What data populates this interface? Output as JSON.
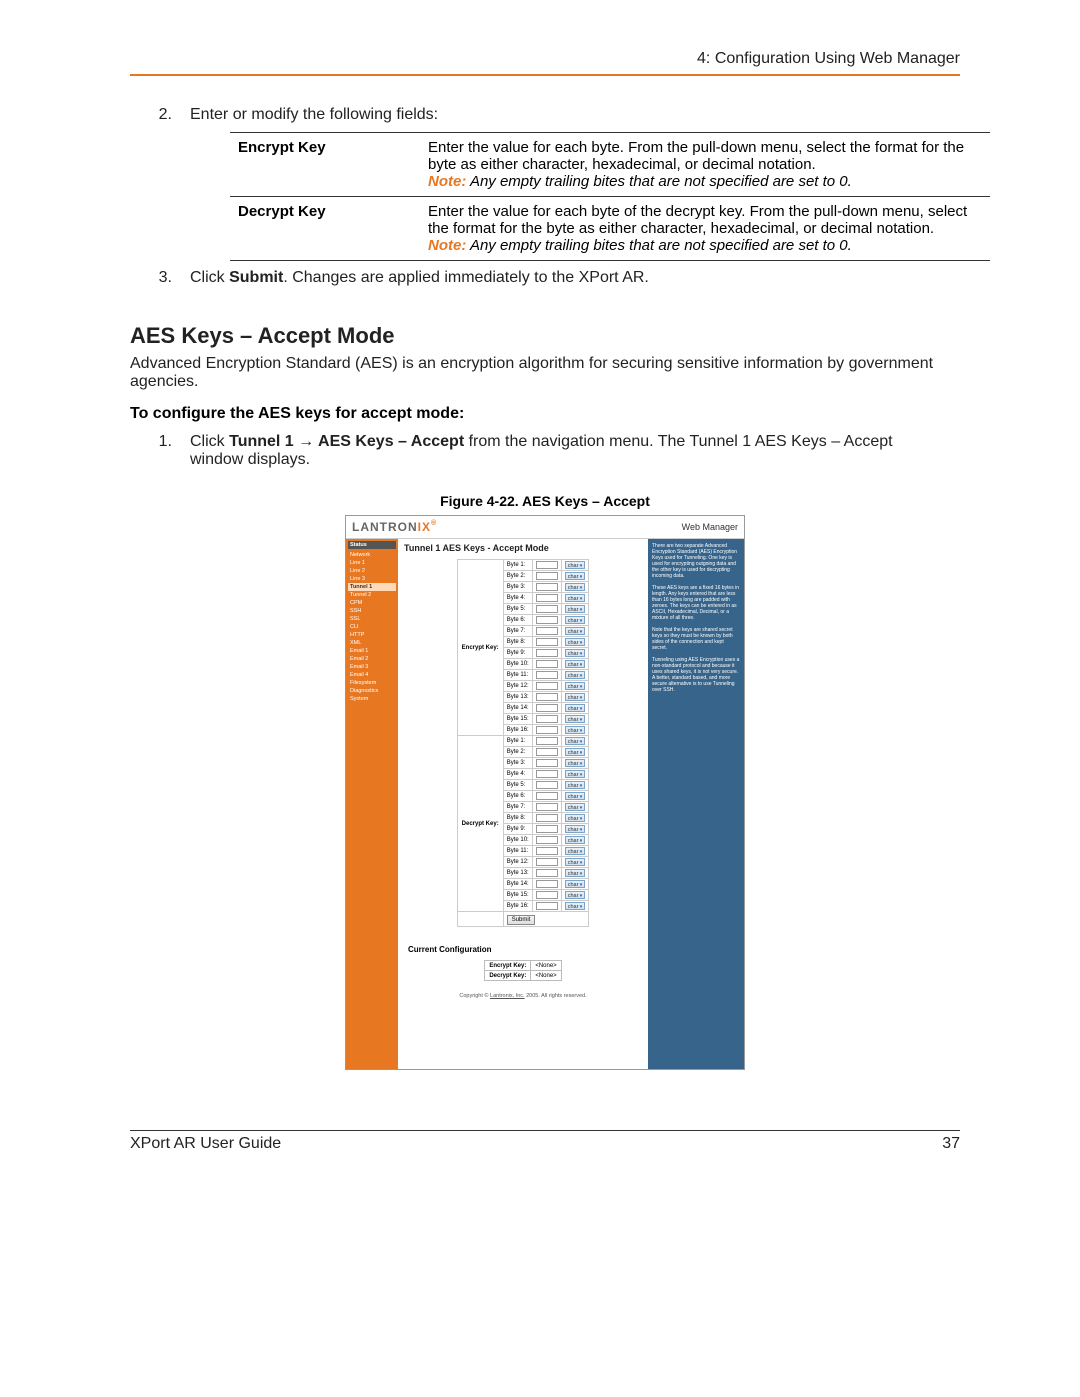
{
  "header": {
    "chapter": "4: Configuration Using Web Manager"
  },
  "steps": {
    "s2": {
      "num": "2.",
      "text": "Enter or modify the following fields:"
    },
    "s3": {
      "num": "3.",
      "prefix": "Click ",
      "bold": "Submit",
      "suffix": ". Changes are applied immediately to the XPort AR."
    }
  },
  "table": {
    "row1": {
      "key": "Encrypt Key",
      "desc": "Enter the value for each byte. From the pull-down menu, select the format for the byte as either character, hexadecimal, or decimal notation.",
      "noteLabel": "Note:",
      "noteBody": " Any empty trailing bites that are not specified are set to 0."
    },
    "row2": {
      "key": "Decrypt Key",
      "desc": "Enter the value for each byte of the decrypt key. From the pull-down menu, select the format for the byte as either character, hexadecimal, or decimal notation.",
      "noteLabel": "Note:",
      "noteBody": " Any empty trailing bites that are not specified are set to 0."
    }
  },
  "section": {
    "title": "AES Keys – Accept Mode",
    "para": "Advanced Encryption Standard (AES) is an encryption algorithm for securing sensitive information by government agencies.",
    "subhead": "To configure the AES keys for accept mode:",
    "step1": {
      "num": "1.",
      "pre": "Click ",
      "b1": "Tunnel 1 ",
      "arrow": "→",
      "b2": " AES Keys – Accept",
      "post": " from the navigation menu. The Tunnel 1 AES Keys – Accept window displays."
    }
  },
  "figure": {
    "caption": "Figure 4-22. AES Keys – Accept",
    "logo1": "LANTRON",
    "logo2": "IX",
    "webmanager": "Web Manager",
    "mainTitle": "Tunnel 1 AES Keys - Accept Mode",
    "nav": [
      "Status",
      "Network",
      "Line 1",
      "Line 2",
      "Line 3",
      "Tunnel 1",
      "Tunnel 2",
      "CPM",
      "SSH",
      "SSL",
      "CLI",
      "HTTP",
      "XML",
      "Email 1",
      "Email 2",
      "Email 3",
      "Email 4",
      "Filesystem",
      "Diagnostics",
      "System"
    ],
    "encryptLabel": "Encrypt Key:",
    "decryptLabel": "Decrypt Key:",
    "bytes": [
      "Byte 1:",
      "Byte 2:",
      "Byte 3:",
      "Byte 4:",
      "Byte 5:",
      "Byte 6:",
      "Byte 7:",
      "Byte 8:",
      "Byte 9:",
      "Byte 10:",
      "Byte 11:",
      "Byte 12:",
      "Byte 13:",
      "Byte 14:",
      "Byte 15:",
      "Byte 16:"
    ],
    "selOpt": "char",
    "submit": "Submit",
    "ccTitle": "Current Configuration",
    "cc": {
      "r1k": "Encrypt Key:",
      "r1v": "<None>",
      "r2k": "Decrypt Key:",
      "r2v": "<None>"
    },
    "footer": {
      "pre": "Copyright © ",
      "link": "Lantronix, Inc.",
      "post": " 2005. All rights reserved."
    },
    "help1": "There are two separate Advanced Encryption Standard (AES) Encryption Keys used for Tunneling. One key is used for encrypting outgoing data and the other key is used for decrypting incoming data.",
    "help2": "These AES keys are a fixed 16 bytes in length. Any keys entered that are less than 16 bytes long are padded with zeroes. The keys can be entered in as ASCII, Hexadecimal, Decimal, or a mixture of all three.",
    "help3": "Note that the keys are shared secret keys so they must be known by both sides of the connection and kept secret.",
    "help4": "Tunneling using AES Encryption uses a non-standard protocol and because it uses shared keys, it is not very secure. A better, standard based, and more secure alternative is to use Tunneling over SSH."
  },
  "footer": {
    "left": "XPort AR User Guide",
    "right": "37"
  }
}
